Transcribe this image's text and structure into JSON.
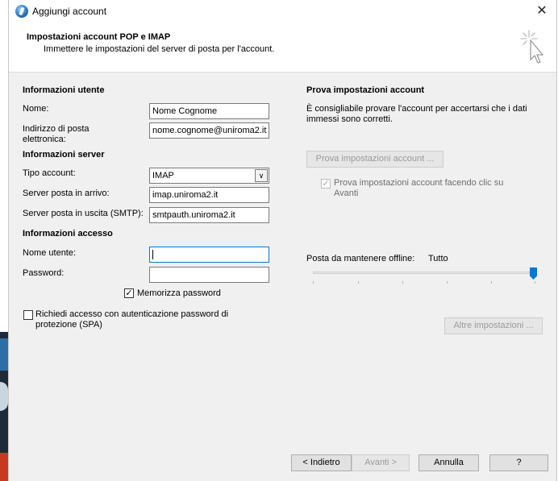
{
  "window": {
    "title": "Aggiungi account",
    "close_glyph": "✕"
  },
  "header": {
    "title": "Impostazioni account POP e IMAP",
    "subtitle": "Immettere le impostazioni del server di posta per l'account."
  },
  "user_info": {
    "section": "Informazioni utente",
    "name_label": "Nome:",
    "name_value": "Nome Cognome",
    "email_label": "Indirizzo di posta elettronica:",
    "email_value": "nome.cognome@uniroma2.it"
  },
  "server_info": {
    "section": "Informazioni server",
    "account_type_label": "Tipo account:",
    "account_type_value": "IMAP",
    "incoming_label": "Server posta in arrivo:",
    "incoming_value": "imap.uniroma2.it",
    "outgoing_label": "Server posta in uscita (SMTP):",
    "outgoing_value": "smtpauth.uniroma2.it"
  },
  "login_info": {
    "section": "Informazioni accesso",
    "username_label": "Nome utente:",
    "username_value": "",
    "password_label": "Password:",
    "password_value": "",
    "remember_label": "Memorizza password",
    "remember_checked": true,
    "spa_label": "Richiedi accesso con autenticazione password di protezione (SPA)",
    "spa_checked": false
  },
  "test": {
    "section": "Prova impostazioni account",
    "description": "È consigliabile provare l'account per accertarsi che i dati immessi sono corretti.",
    "test_button": "Prova impostazioni account ...",
    "auto_test_label": "Prova impostazioni account facendo clic su Avanti",
    "auto_test_checked": true
  },
  "offline": {
    "label": "Posta da mantenere offline:",
    "value": "Tutto",
    "slider_level": 1.0
  },
  "buttons": {
    "more_settings": "Altre impostazioni ...",
    "back": "< Indietro",
    "next": "Avanti >",
    "cancel": "Annulla",
    "help": "?"
  },
  "colors": {
    "accent": "#0078d7",
    "dialog_bg": "#f0f0f0"
  },
  "icons": [
    "outlook-app-icon",
    "close-icon",
    "wizard-cursor-icon",
    "checkmark-icon",
    "chevron-down-icon"
  ]
}
